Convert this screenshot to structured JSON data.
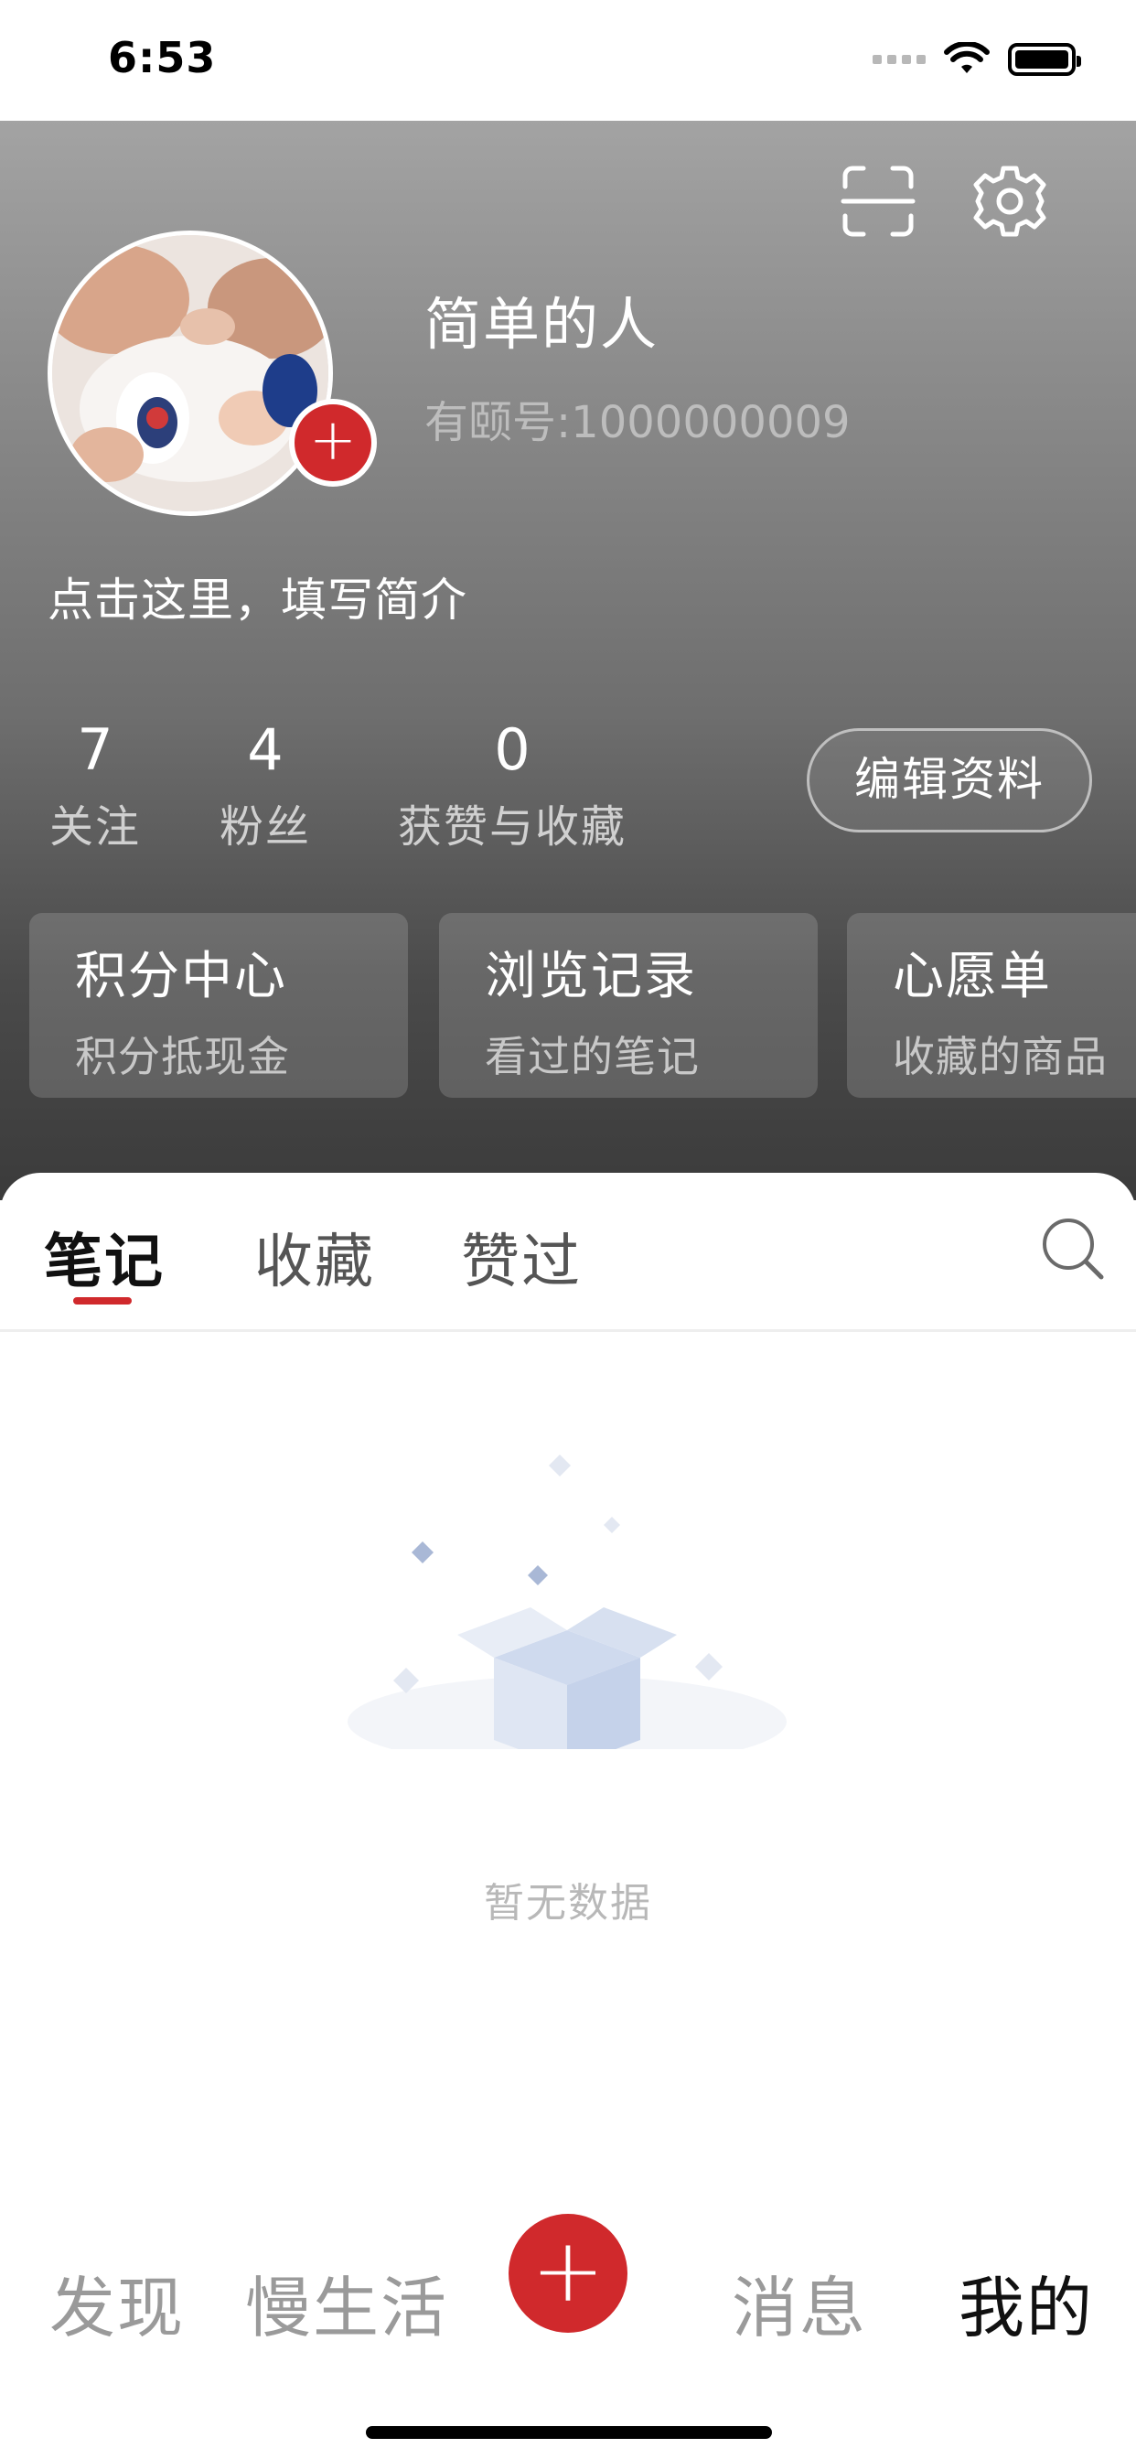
{
  "status_bar": {
    "time": "6:53"
  },
  "header": {
    "user_name": "简单的人",
    "user_id": "有颐号:1000000009",
    "bio_prompt": "点击这里，填写简介",
    "edit_profile_label": "编辑资料",
    "stats": [
      {
        "value": "7",
        "label": "关注"
      },
      {
        "value": "4",
        "label": "粉丝"
      },
      {
        "value": "0",
        "label": "获赞与收藏"
      }
    ],
    "quick_cards": [
      {
        "title": "积分中心",
        "subtitle": "积分抵现金"
      },
      {
        "title": "浏览记录",
        "subtitle": "看过的笔记"
      },
      {
        "title": "心愿单",
        "subtitle": "收藏的商品"
      }
    ]
  },
  "content_tabs": [
    {
      "label": "笔记",
      "active": true
    },
    {
      "label": "收藏",
      "active": false
    },
    {
      "label": "赞过",
      "active": false
    }
  ],
  "empty_state": {
    "text": "暂无数据"
  },
  "bottom_nav": {
    "items": [
      {
        "label": "发现",
        "active": false
      },
      {
        "label": "慢生活",
        "active": false
      },
      {
        "label": "消息",
        "active": false
      },
      {
        "label": "我的",
        "active": true
      }
    ],
    "publish_icon": "plus-icon"
  },
  "colors": {
    "accent": "#d0292c",
    "header_top": "#a3a3a3",
    "header_bottom": "#3b3b3b"
  }
}
